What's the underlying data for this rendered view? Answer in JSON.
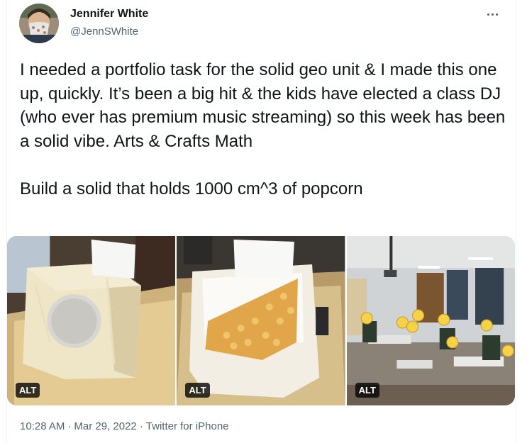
{
  "author": {
    "name": "Jennifer White",
    "handle": "@JennSWhite",
    "avatar": "avatar-photo-masked"
  },
  "tweet": {
    "text": "I needed a portfolio task for the solid geo unit & I made this one up, quickly. It’s been a big hit & the kids have elected a class DJ (who ever has premium music streaming) so this week has been a solid vibe. Arts & Crafts Math\n\nBuild a solid that holds 1000 cm^3 of popcorn"
  },
  "media": [
    {
      "alt_badge": "ALT",
      "subject": "taped paper box with hole on tray"
    },
    {
      "alt_badge": "ALT",
      "subject": "paper box filled with popcorn kernels"
    },
    {
      "alt_badge": "ALT",
      "subject": "classroom with students, emoji-covered faces"
    }
  ],
  "meta": {
    "time": "10:28 AM",
    "separator": "·",
    "date": "Mar 29, 2022",
    "source": "Twitter for iPhone"
  },
  "icons": {
    "more": "more-horizontal-icon"
  },
  "colors": {
    "text": "#0f1419",
    "secondary": "#536471",
    "background": "#ffffff"
  }
}
